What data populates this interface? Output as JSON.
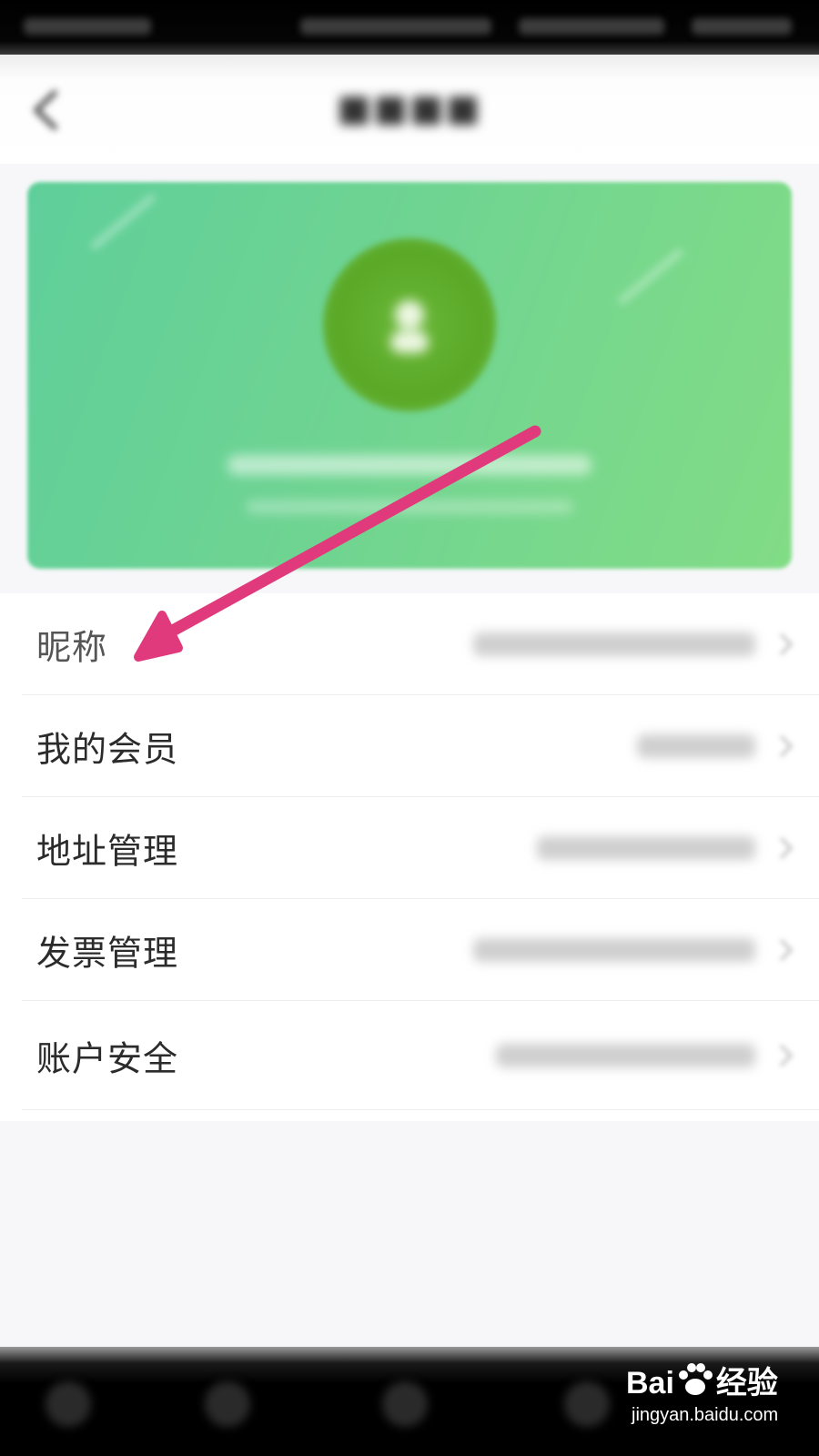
{
  "menu": {
    "items": [
      {
        "label": "昵称"
      },
      {
        "label": "我的会员"
      },
      {
        "label": "地址管理"
      },
      {
        "label": "发票管理"
      },
      {
        "label": "账户安全"
      }
    ]
  },
  "watermark": {
    "brand_a": "Bai",
    "brand_b": "经验",
    "site": "jingyan.baidu.com"
  },
  "colors": {
    "card_start": "#5fcf9a",
    "card_end": "#82dc86",
    "avatar": "#5aa825",
    "annotation_arrow": "#e03a7c"
  },
  "icons": [
    "back-icon",
    "avatar-icon",
    "chevron-right-icon",
    "paw-icon"
  ]
}
